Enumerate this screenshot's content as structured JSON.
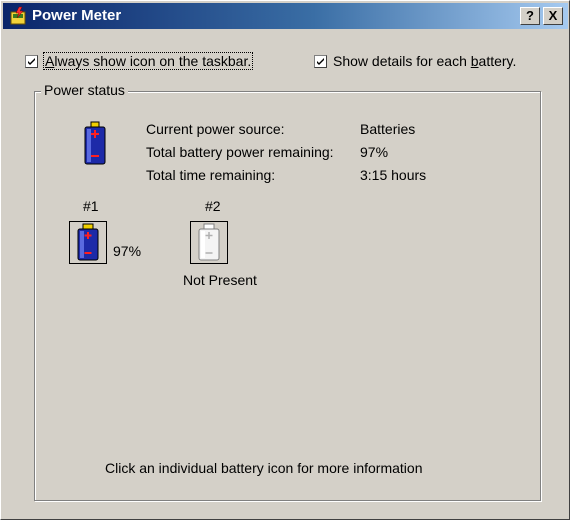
{
  "window": {
    "title": "Power Meter",
    "help_label": "?",
    "close_label": "X",
    "app_icon": "battery-meter-icon"
  },
  "options": {
    "always_show_icon": {
      "checked": true,
      "pre": "",
      "underline": "A",
      "post": "lways show icon on the taskbar."
    },
    "show_details": {
      "checked": true,
      "pre": "Show details for each ",
      "underline": "b",
      "post": "attery."
    }
  },
  "power_status": {
    "group_label": "Power status",
    "rows": [
      {
        "label": "Current power source:",
        "value": "Batteries"
      },
      {
        "label": "Total battery power remaining:",
        "value": "97%"
      },
      {
        "label": "Total time remaining:",
        "value": "3:15 hours"
      }
    ],
    "batteries": [
      {
        "number": "#1",
        "status": "97%",
        "icon": "battery-full-icon"
      },
      {
        "number": "#2",
        "status": "Not Present",
        "icon": "battery-empty-icon"
      }
    ],
    "footer": "Click an individual battery icon for more information"
  },
  "colors": {
    "title_gradient_start": "#0a246a",
    "title_gradient_end": "#a6caf0",
    "battery_blue": "#1d2aa8",
    "battery_cap_yellow": "#f0d000",
    "face": "#d4d0c8"
  }
}
